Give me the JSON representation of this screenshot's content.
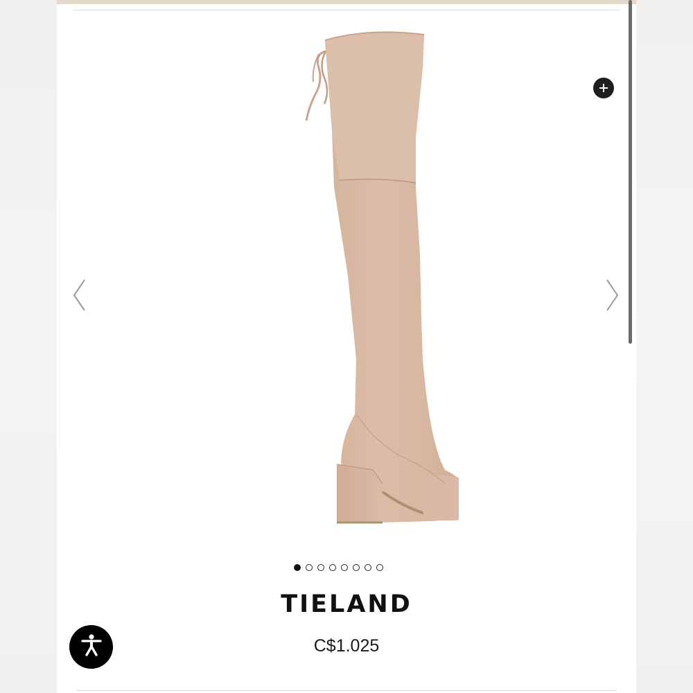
{
  "product": {
    "name": "TIELAND",
    "price": "C$1.025",
    "image_icon": "over-the-knee-boot-image",
    "boot_color": "#d9b9a3"
  },
  "carousel": {
    "total_slides": 8,
    "active_index": 0,
    "prev_icon": "chevron-left-icon",
    "next_icon": "chevron-right-icon"
  },
  "controls": {
    "zoom_icon": "plus-circle-icon",
    "accessibility_icon": "accessibility-icon"
  },
  "colors": {
    "accent_band": "#e7d8ca",
    "text": "#111111",
    "button_dark": "#1f1f1f"
  }
}
